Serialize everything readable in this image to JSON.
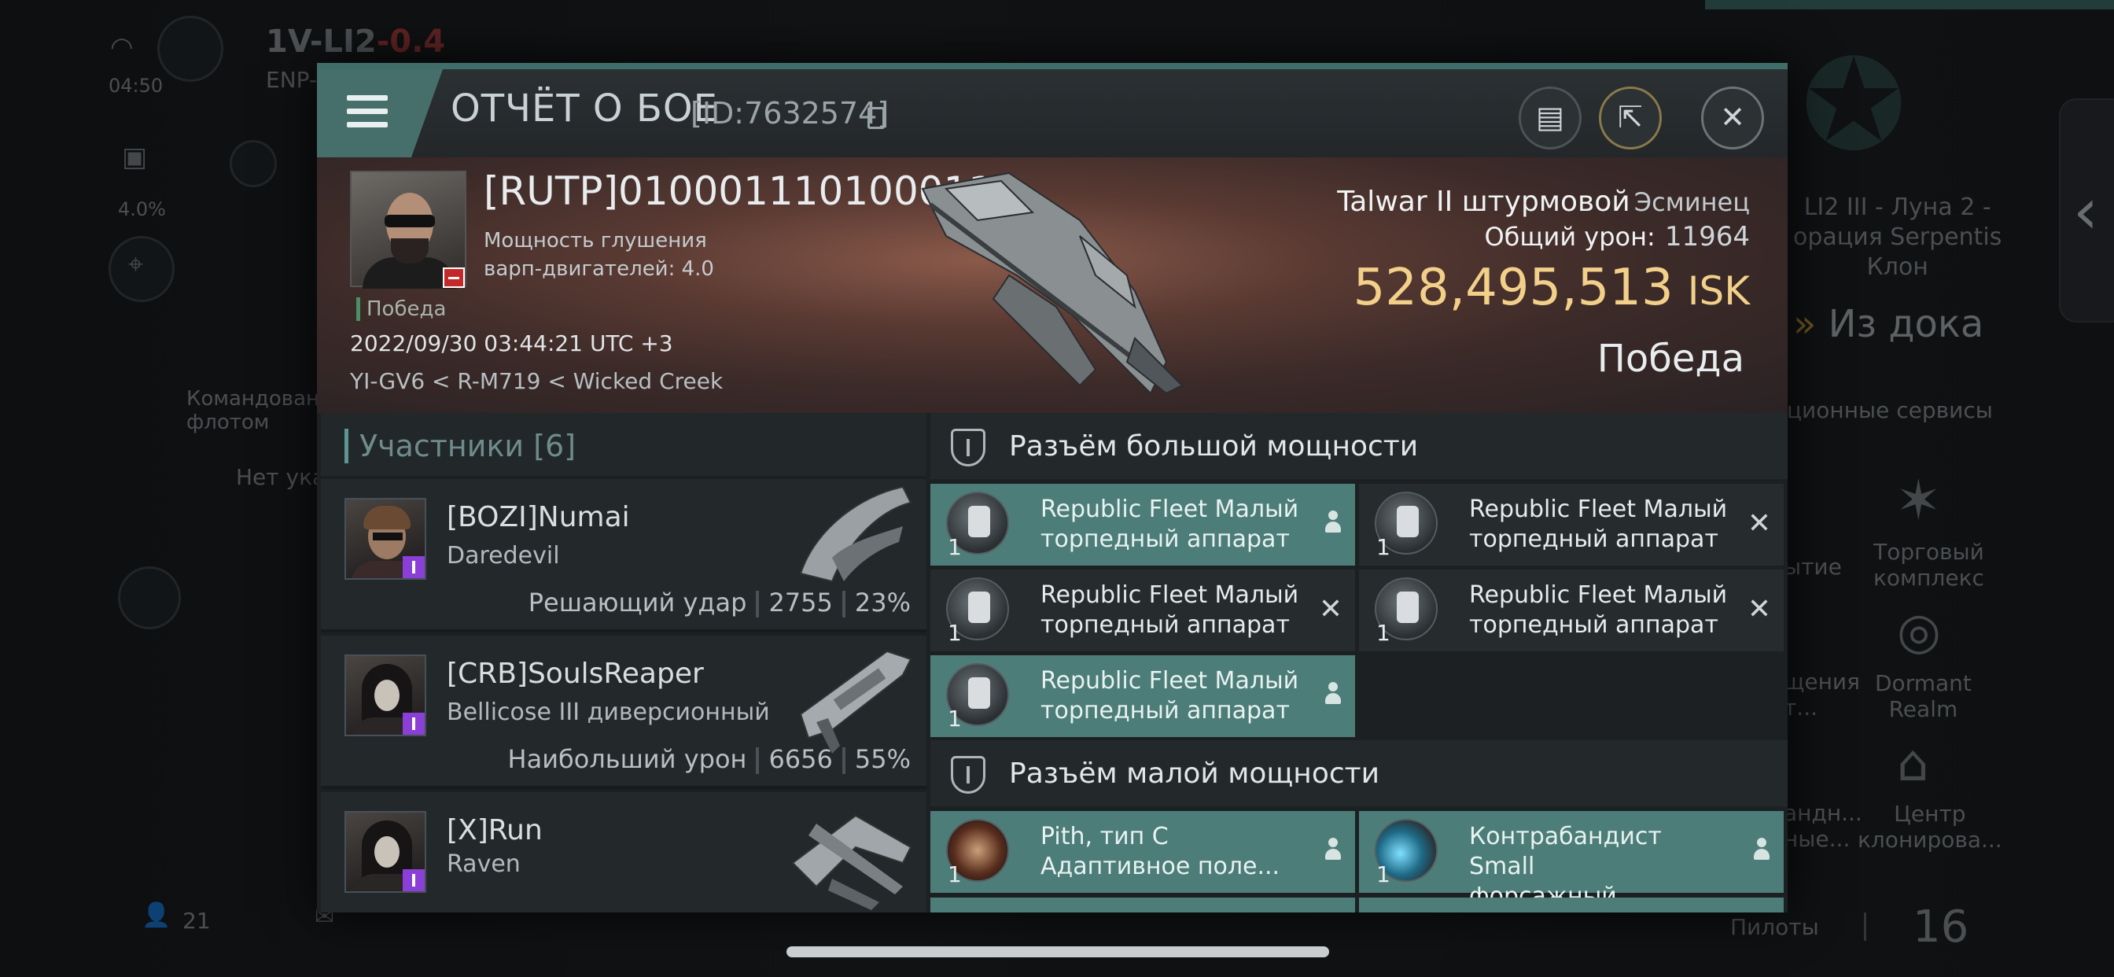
{
  "background": {
    "system": "1V-LI2",
    "security": "-0.4",
    "system_sub": "ENP-",
    "time": "04:50",
    "percent": "4.0%",
    "left_label": "Командован\nфлотом",
    "left_none": "Нет ука",
    "right_location": "LI2 III - Луна 2 -\nорация Serpentis\nКлон",
    "undock": "Из дока",
    "services": "ционные сервисы",
    "svc_1": "ытие",
    "svc_trade": "Торговый\nкомплекс",
    "svc_3": "щения\nт...",
    "svc_dormant": "Dormant\nRealm",
    "svc_5": "андн...\nные...",
    "svc_clone": "Центр\nклонирова...",
    "bottom_count": "21",
    "pilots_label": "Пилоты",
    "pilots_count": "16"
  },
  "report": {
    "title": "ОТЧЁТ О БОЕ",
    "id": "[ID:7632574]",
    "victim": {
      "name": "[RUTP]010001110100011",
      "stat": "Мощность глушения\nварп-двигателей: 4.0",
      "tag": "Победа",
      "date": "2022/09/30 03:44:21 UTC +3",
      "location": "YI-GV6 < R-M719 < Wicked Creek"
    },
    "ship": {
      "name": "Talwar II штурмовой",
      "class": "Эсминец",
      "damage_label": "Общий урон:",
      "damage_value": "11964",
      "isk_value": "528,495,513",
      "isk_unit": "ISK",
      "result": "Победа"
    },
    "participants": {
      "header": "Участники [6]",
      "list": [
        {
          "name": "[BOZI]Numai",
          "ship": "Daredevil",
          "stat_label": "Решающий удар",
          "damage": "2755",
          "percent": "23%"
        },
        {
          "name": "[CRB]SoulsReaper",
          "ship": "Bellicose III диверсионный",
          "stat_label": "Наибольший урон",
          "damage": "6656",
          "percent": "55%"
        },
        {
          "name": "[X]Run",
          "ship": "Raven",
          "stat_label": "",
          "damage": "",
          "percent": ""
        }
      ]
    },
    "high_slots": {
      "title": "Разъём большой мощности",
      "modules": [
        {
          "qty": "1",
          "name": "Republic Fleet Малый торпедный аппарат",
          "state": "dropped",
          "icon": "torpedo-launcher-icon"
        },
        {
          "qty": "1",
          "name": "Republic Fleet Малый торпедный аппарат",
          "state": "destroyed",
          "icon": "torpedo-launcher-icon"
        },
        {
          "qty": "1",
          "name": "Republic Fleet Малый торпедный аппарат",
          "state": "destroyed",
          "icon": "torpedo-launcher-icon"
        },
        {
          "qty": "1",
          "name": "Republic Fleet Малый торпедный аппарат",
          "state": "destroyed",
          "icon": "torpedo-launcher-icon"
        },
        {
          "qty": "1",
          "name": "Republic Fleet Малый торпедный аппарат",
          "state": "dropped",
          "icon": "torpedo-launcher-icon"
        }
      ]
    },
    "low_slots": {
      "title": "Разъём малой мощности",
      "modules": [
        {
          "qty": "1",
          "name": "Pith, тип C\nАдаптивное поле...",
          "state": "dropped",
          "icon": "shield-hardener-icon"
        },
        {
          "qty": "1",
          "name": "Контрабандист Small\nфорсажный...",
          "state": "dropped",
          "icon": "afterburner-icon"
        }
      ]
    }
  },
  "colors": {
    "accent": "#4c7d78",
    "isk": "#f2d08a",
    "badge_red": "#c42828",
    "badge_purple": "#8a3fd6"
  }
}
